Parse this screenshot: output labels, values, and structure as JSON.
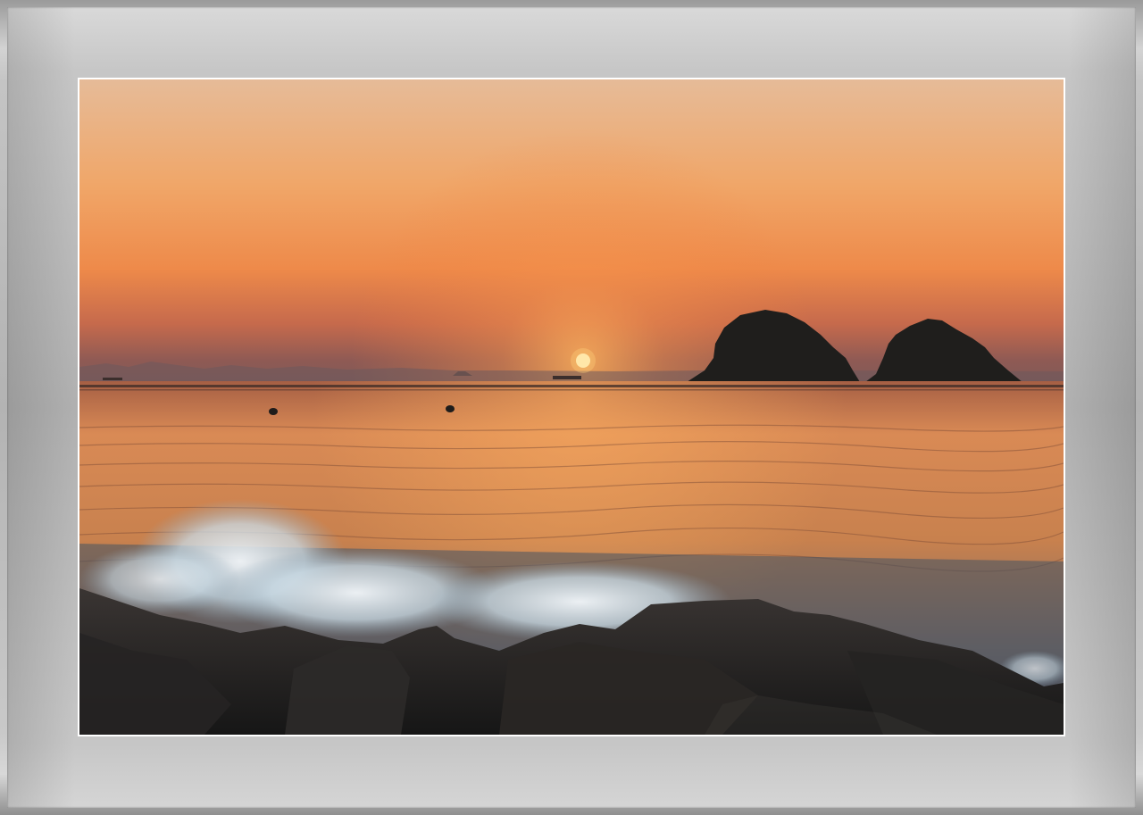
{
  "scene": {
    "subject": "sunset-over-sea-with-rocky-islets",
    "colors": {
      "sky_top": "#e3b894",
      "sky_mid": "#f2a062",
      "sky_horizon": "#c46a4e",
      "sun": "#fff1b8",
      "sea": "#d68650",
      "rocks": "#262626",
      "spray": "#e8f0f4",
      "frame": "#b5b5b5"
    },
    "icons": [
      "sun",
      "islet-left",
      "islet-right",
      "buoy",
      "wave-spray",
      "foreground-rocks"
    ]
  }
}
